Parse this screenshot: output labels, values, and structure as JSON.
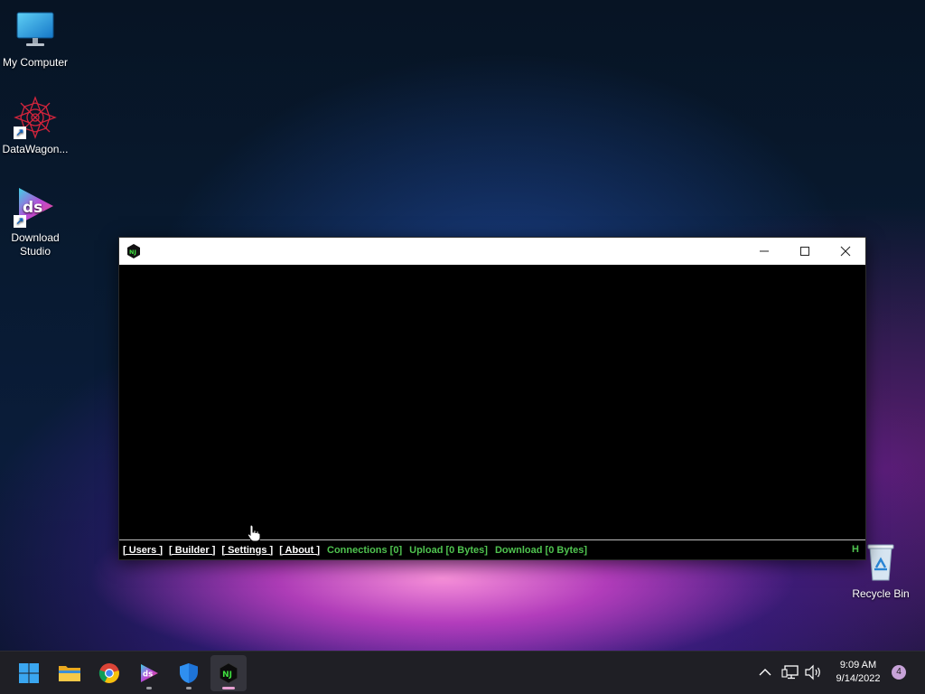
{
  "desktop": {
    "icons": [
      {
        "label": "My Computer",
        "icon": "monitor-icon",
        "shortcut": false
      },
      {
        "label": "DataWagon...",
        "icon": "datawagon-icon",
        "shortcut": true
      },
      {
        "label": "Download Studio",
        "icon": "download-studio-icon",
        "shortcut": true
      },
      {
        "label": "Recycle Bin",
        "icon": "recycle-bin-icon",
        "shortcut": false
      }
    ]
  },
  "window": {
    "title": "",
    "app_icon": "njrat-icon",
    "controls": {
      "minimize": "minimize-icon",
      "maximize": "maximize-icon",
      "close": "close-icon"
    },
    "statusbar": {
      "menu": [
        "[ Users ]",
        "[ Builder ]",
        "[ Settings ]",
        "[ About ]"
      ],
      "connections": "Connections [0]",
      "upload": "Upload [0 Bytes]",
      "download": "Download [0 Bytes]",
      "right_text": "H"
    }
  },
  "taskbar": {
    "apps": [
      "start-icon",
      "file-explorer-icon",
      "chrome-icon",
      "download-studio-icon",
      "defender-icon",
      "njrat-icon"
    ],
    "tray": {
      "time": "9:09 AM",
      "date": "9/14/2022",
      "notifications": "4"
    }
  },
  "colors": {
    "status_green": "#4fc34f",
    "taskbar": "#1f1f25"
  }
}
